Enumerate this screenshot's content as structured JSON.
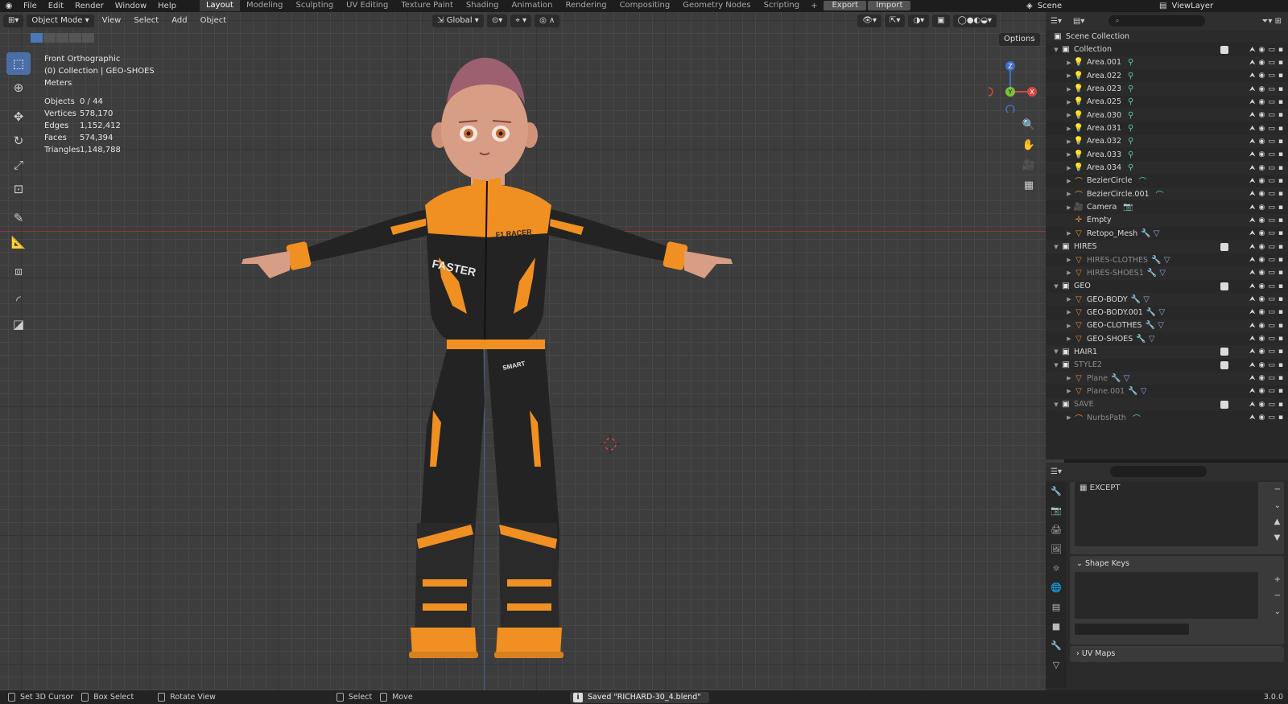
{
  "topbar": {
    "menus": [
      "File",
      "Edit",
      "Render",
      "Window",
      "Help"
    ],
    "workspaces": [
      "Layout",
      "Modeling",
      "Sculpting",
      "UV Editing",
      "Texture Paint",
      "Shading",
      "Animation",
      "Rendering",
      "Compositing",
      "Geometry Nodes",
      "Scripting"
    ],
    "active_workspace": "Layout",
    "export_label": "Export",
    "import_label": "Import",
    "scene": "Scene",
    "view_layer": "ViewLayer"
  },
  "viewport": {
    "mode": "Object Mode",
    "menus": [
      "View",
      "Select",
      "Add",
      "Object"
    ],
    "orientation": "Global",
    "options_label": "Options",
    "overlay": {
      "view_name": "Front Orthographic",
      "collection_info": "(0) Collection | GEO-SHOES",
      "units": "Meters",
      "stats": [
        {
          "label": "Objects",
          "value": "0 / 44"
        },
        {
          "label": "Vertices",
          "value": "578,170"
        },
        {
          "label": "Edges",
          "value": "1,152,412"
        },
        {
          "label": "Faces",
          "value": "574,394"
        },
        {
          "label": "Triangles",
          "value": "1,148,788"
        }
      ]
    },
    "gizmo": {
      "z": "Z",
      "y": "Y",
      "x": "X"
    },
    "suit": {
      "chest": "F1 RACER",
      "logo": "FASTER",
      "belt": "SMART"
    }
  },
  "outliner": {
    "root": "Scene Collection",
    "rows": [
      {
        "name": "Collection",
        "type": "collection",
        "level": 0
      },
      {
        "name": "Area.001",
        "type": "light",
        "level": 1
      },
      {
        "name": "Area.022",
        "type": "light",
        "level": 1
      },
      {
        "name": "Area.023",
        "type": "light",
        "level": 1
      },
      {
        "name": "Area.025",
        "type": "light",
        "level": 1
      },
      {
        "name": "Area.030",
        "type": "light",
        "level": 1
      },
      {
        "name": "Area.031",
        "type": "light",
        "level": 1
      },
      {
        "name": "Area.032",
        "type": "light",
        "level": 1
      },
      {
        "name": "Area.033",
        "type": "light",
        "level": 1
      },
      {
        "name": "Area.034",
        "type": "light",
        "level": 1
      },
      {
        "name": "BezierCircle",
        "type": "curve",
        "level": 1
      },
      {
        "name": "BezierCircle.001",
        "type": "curve",
        "level": 1
      },
      {
        "name": "Camera",
        "type": "camera",
        "level": 1
      },
      {
        "name": "Empty",
        "type": "empty",
        "level": 1
      },
      {
        "name": "Retopo_Mesh",
        "type": "mesh",
        "level": 1
      },
      {
        "name": "HIRES",
        "type": "collection",
        "level": 0
      },
      {
        "name": "HIRES-CLOTHES",
        "type": "mesh",
        "level": 1,
        "dim": true
      },
      {
        "name": "HIRES-SHOES1",
        "type": "mesh",
        "level": 1,
        "dim": true
      },
      {
        "name": "GEO",
        "type": "collection",
        "level": 0
      },
      {
        "name": "GEO-BODY",
        "type": "mesh",
        "level": 1
      },
      {
        "name": "GEO-BODY.001",
        "type": "mesh",
        "level": 1
      },
      {
        "name": "GEO-CLOTHES",
        "type": "mesh",
        "level": 1
      },
      {
        "name": "GEO-SHOES",
        "type": "mesh",
        "level": 1
      },
      {
        "name": "HAIR1",
        "type": "collection",
        "level": 0
      },
      {
        "name": "STYLE2",
        "type": "collection",
        "level": 0,
        "dim": true
      },
      {
        "name": "Plane",
        "type": "mesh",
        "level": 1,
        "dim": true
      },
      {
        "name": "Plane.001",
        "type": "mesh",
        "level": 1,
        "dim": true
      },
      {
        "name": "SAVE",
        "type": "collection",
        "level": 0,
        "dim": true
      },
      {
        "name": "NurbsPath",
        "type": "curve",
        "level": 1,
        "dim": true
      }
    ]
  },
  "properties": {
    "except_label": "EXCEPT",
    "shape_keys_label": "Shape Keys",
    "uv_maps_label": "UV Maps"
  },
  "statusbar": {
    "items": [
      "Set 3D Cursor",
      "Box Select",
      "Rotate View",
      "Select",
      "Move"
    ],
    "message": "Saved \"RICHARD-30_4.blend\"",
    "version": "3.0.0"
  }
}
